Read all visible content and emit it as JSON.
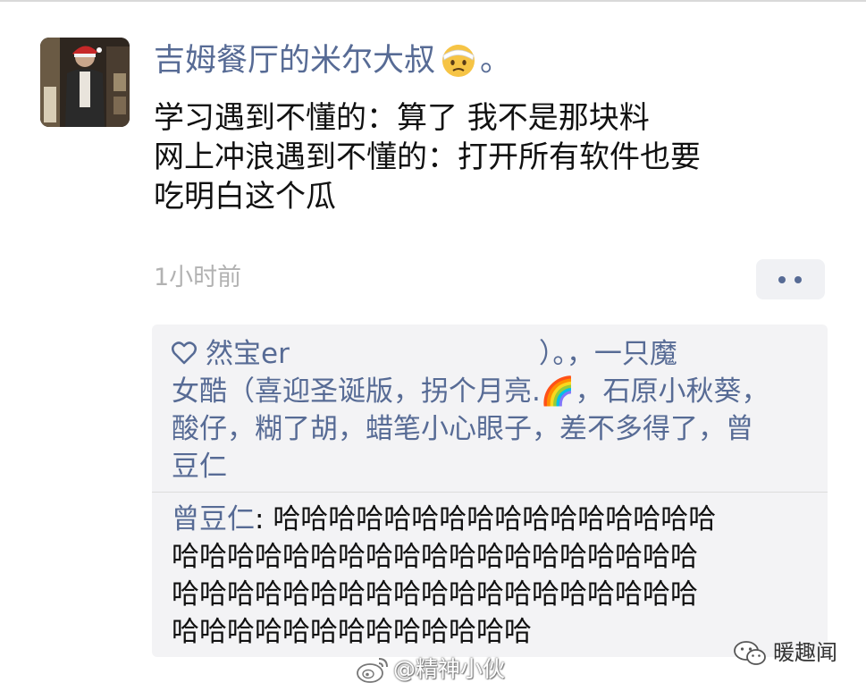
{
  "post": {
    "username": "吉姆餐厅的米尔大叔",
    "username_suffix": "。",
    "emoji": "face-with-head-bandage-emoji",
    "lines": [
      "学习遇到不懂的：算了 我不是那块料",
      "网上冲浪遇到不懂的：打开所有软件也要",
      "吃明白这个瓜"
    ],
    "time": "1小时前"
  },
  "likes": {
    "lines": [
      "然宝er　　　　　　　　　）。，一只魔",
      "女酷（喜迎圣诞版，拐个月亮.🌈，石原小秋葵，",
      "酸仔，糊了胡，蜡笔小心眼子，差不多得了，曾",
      "豆仁"
    ]
  },
  "comment": {
    "author": "曾豆仁",
    "separator": ": ",
    "lines": [
      "哈哈哈哈哈哈哈哈哈哈哈哈哈哈哈哈",
      "哈哈哈哈哈哈哈哈哈哈哈哈哈哈哈哈哈哈哈",
      "哈哈哈哈哈哈哈哈哈哈哈哈哈哈哈哈哈哈哈",
      "哈哈哈哈哈哈哈哈哈哈哈哈哈"
    ]
  },
  "watermarks": {
    "wechat_name": "暖趣闻",
    "weibo_handle": "@精神小伙"
  },
  "colors": {
    "link": "#576b95",
    "text": "#111111",
    "meta": "#b2b2b2",
    "box": "#f3f3f5"
  }
}
